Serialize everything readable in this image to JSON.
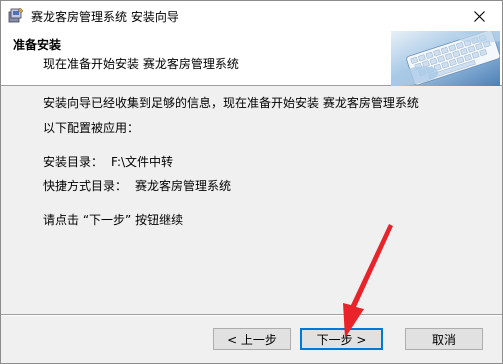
{
  "window": {
    "title": "赛龙客房管理系统 安装向导"
  },
  "header": {
    "title": "准备安装",
    "subtitle": "现在准备开始安装 赛龙客房管理系统"
  },
  "content": {
    "intro": "安装向导已经收集到足够的信息，现在准备开始安装 赛龙客房管理系统",
    "config_label": "以下配置被应用：",
    "install_dir_label": "安装目录：",
    "install_dir_value": "F:\\文件中转",
    "shortcut_label": "快捷方式目录：",
    "shortcut_value": "赛龙客房管理系统",
    "instruction": "请点击 “下一步” 按钮继续"
  },
  "buttons": {
    "back": "< 上一步",
    "next": "下一步 >",
    "cancel": "取消"
  },
  "annotation": {
    "arrow_color": "#e8232a"
  }
}
